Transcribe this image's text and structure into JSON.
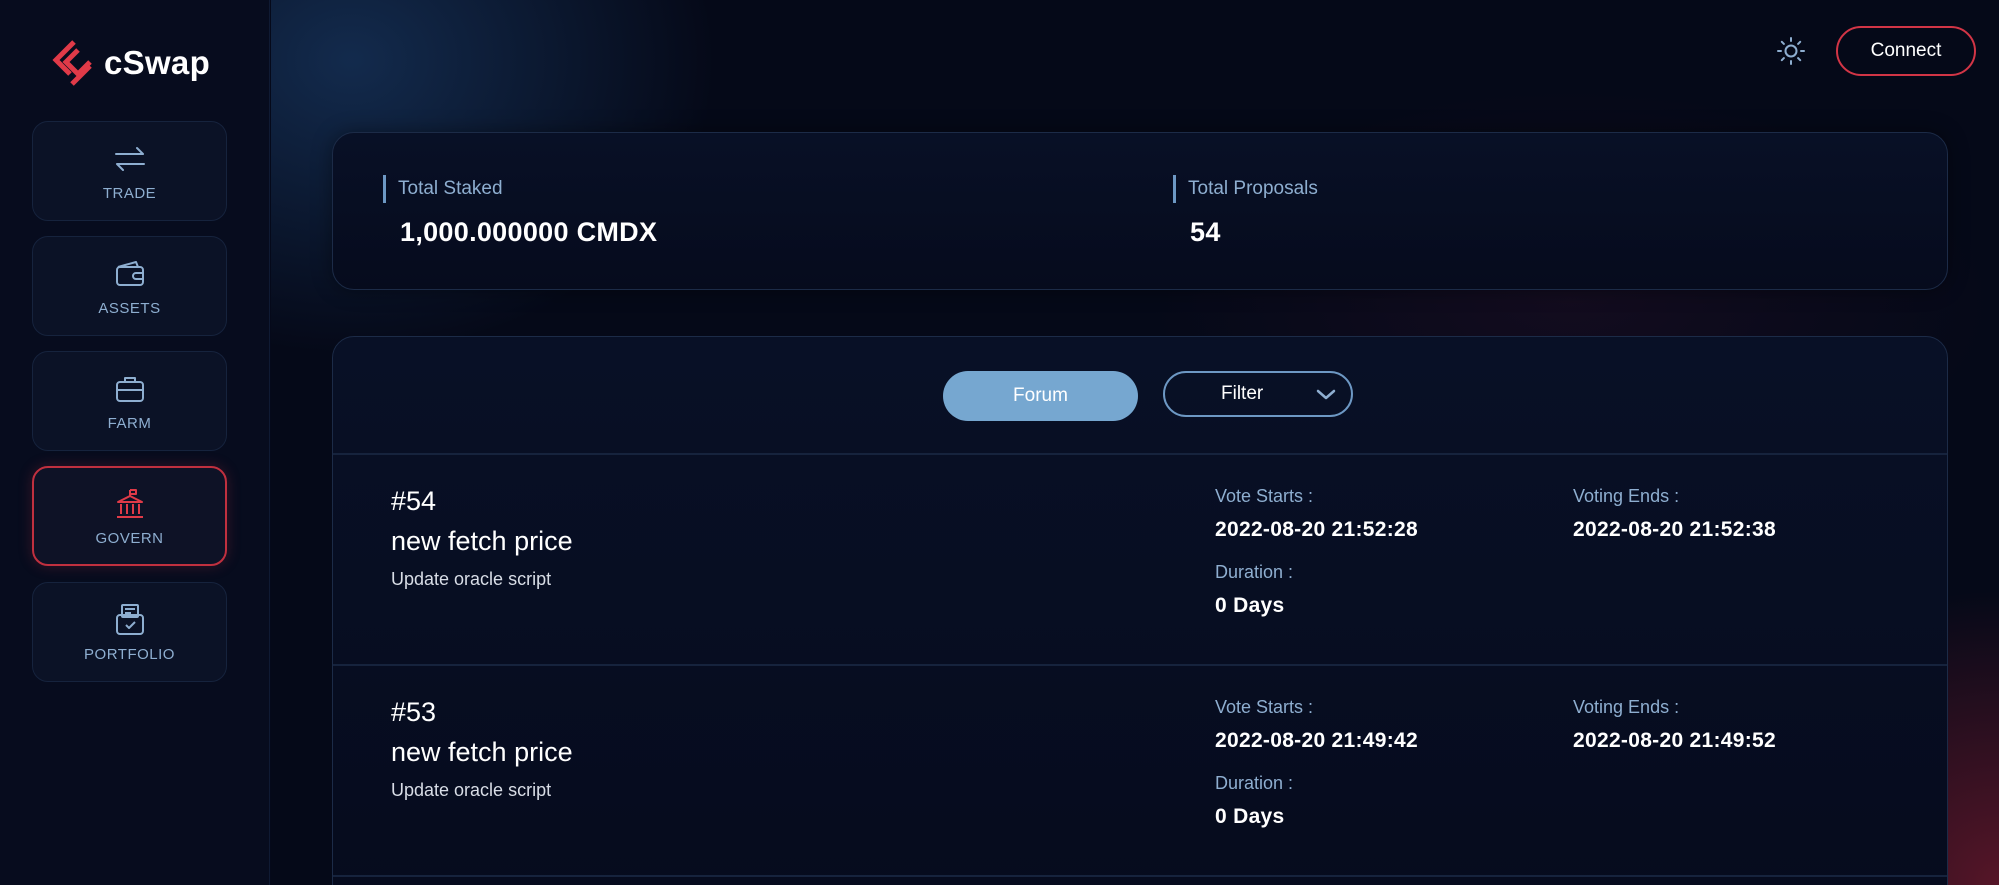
{
  "app": {
    "name": "cSwap"
  },
  "colors": {
    "accent_red": "#d23546",
    "accent_blue": "#76a7d0",
    "label_blue": "#8eaed0"
  },
  "sidebar": {
    "items": [
      {
        "label": "TRADE",
        "icon": "arrows-swap-icon",
        "active": false
      },
      {
        "label": "ASSETS",
        "icon": "wallet-icon",
        "active": false
      },
      {
        "label": "FARM",
        "icon": "briefcase-icon",
        "active": false
      },
      {
        "label": "GOVERN",
        "icon": "bank-icon",
        "active": true
      },
      {
        "label": "PORTFOLIO",
        "icon": "portfolio-icon",
        "active": false
      }
    ]
  },
  "header": {
    "theme_icon": "sun-icon",
    "connect_label": "Connect"
  },
  "stats": {
    "total_staked_label": "Total Staked",
    "total_staked_value": "1,000.000000 CMDX",
    "total_proposals_label": "Total Proposals",
    "total_proposals_value": "54"
  },
  "toolbar": {
    "forum_label": "Forum",
    "filter_label": "Filter"
  },
  "proposals": [
    {
      "number": "#54",
      "title": "new fetch price",
      "description": "Update oracle script",
      "vote_starts_label": "Vote Starts :",
      "vote_starts": "2022-08-20 21:52:28",
      "voting_ends_label": "Voting Ends :",
      "voting_ends": "2022-08-20 21:52:38",
      "duration_label": "Duration :",
      "duration": "0 Days"
    },
    {
      "number": "#53",
      "title": "new fetch price",
      "description": "Update oracle script",
      "vote_starts_label": "Vote Starts :",
      "vote_starts": "2022-08-20 21:49:42",
      "voting_ends_label": "Voting Ends :",
      "voting_ends": "2022-08-20 21:49:52",
      "duration_label": "Duration :",
      "duration": "0 Days"
    }
  ]
}
